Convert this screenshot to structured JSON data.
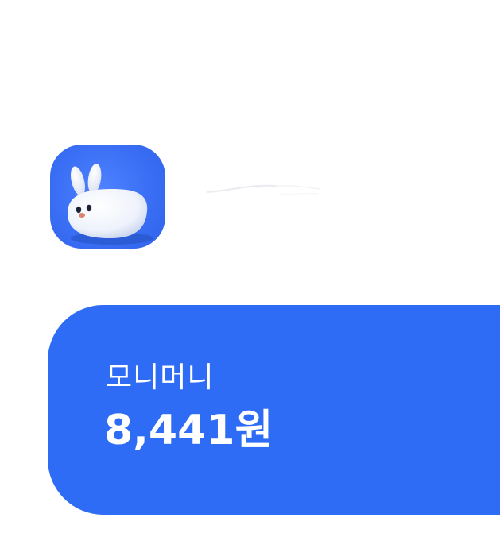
{
  "app": {
    "icon": "bunny-mascot-icon"
  },
  "balance_card": {
    "label": "모니머니",
    "amount": "8,441원"
  },
  "colors": {
    "card_background": "#2f6cf5",
    "icon_background": "#3a6ff5",
    "text_on_card": "#ffffff"
  }
}
